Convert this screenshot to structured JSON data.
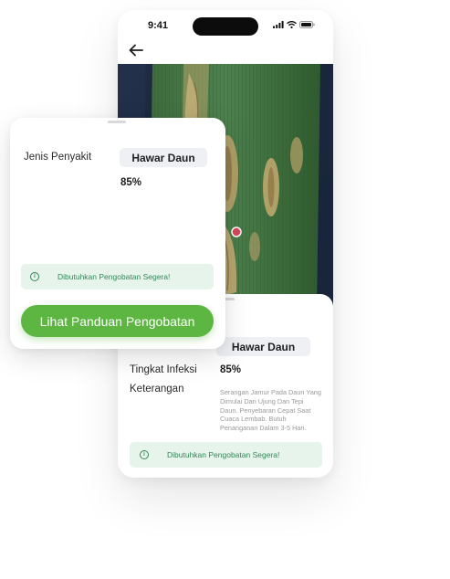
{
  "status_bar": {
    "time": "9:41"
  },
  "result": {
    "disease_label": "Jenis Penyakit",
    "disease_value": "Hawar Daun",
    "infection_label": "Tingkat Infeksi",
    "infection_value": "85%",
    "description_label": "Keterangan",
    "description_text": "Serangan Jamur Pada Daun Yang Dimulai Dari Ujung Dan Tepi Daun. Penyebaran Cepat Saat Cuaca Lembab. Butuh Penanganan Dalam 3-5 Hari.",
    "alert_text": "Dibutuhkan Pengobatan Segera!"
  },
  "cta": {
    "label": "Lihat Panduan Pengobatan"
  },
  "colors": {
    "accent_green": "#5db642",
    "alert_bg": "#e6f4ec",
    "alert_text": "#2f8a55",
    "marker": "#d9465a"
  },
  "icons": [
    "back-arrow-icon",
    "signal-icon",
    "wifi-icon",
    "battery-icon",
    "info-icon"
  ]
}
